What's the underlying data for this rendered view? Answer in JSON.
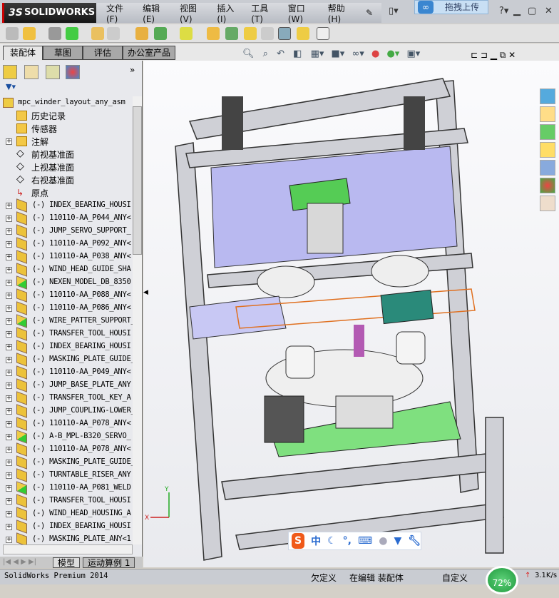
{
  "app": {
    "brand": "SOLIDWORKS",
    "edition": "SolidWorks Premium 2014"
  },
  "menu": [
    "文件(F)",
    "编辑(E)",
    "视图(V)",
    "插入(I)",
    "工具(T)",
    "窗口(W)",
    "帮助(H)"
  ],
  "upload_popup": "拖拽上传",
  "tabs": [
    "装配体",
    "草图",
    "评估",
    "办公室产品"
  ],
  "tree": {
    "root": "mpc_winder_layout_any_asm",
    "folders": [
      "历史记录",
      "传感器",
      "注解",
      "前视基准面",
      "上视基准面",
      "右视基准面",
      "原点"
    ],
    "components": [
      {
        "name": "(-) INDEX_BEARING_HOUSI",
        "type": "part"
      },
      {
        "name": "(-) 110110-AA_P044_ANY<",
        "type": "part"
      },
      {
        "name": "(-) JUMP_SERVO_SUPPORT_",
        "type": "part"
      },
      {
        "name": "(-) 110110-AA_P092_ANY<",
        "type": "part"
      },
      {
        "name": "(-) 110110-AA_P038_ANY<",
        "type": "part"
      },
      {
        "name": "(-) WIND_HEAD_GUIDE_SHA",
        "type": "part"
      },
      {
        "name": "(-) NEXEN_MODEL_DB_8350",
        "type": "assembly"
      },
      {
        "name": "(-) 110110-AA_P088_ANY<",
        "type": "part"
      },
      {
        "name": "(-) 110110-AA_P086_ANY<",
        "type": "part"
      },
      {
        "name": "(-) WIRE_PATTER_SUPPORT_",
        "type": "assembly"
      },
      {
        "name": "(-) TRANSFER_TOOL_HOUSI",
        "type": "part"
      },
      {
        "name": "(-) INDEX_BEARING_HOUSI",
        "type": "part"
      },
      {
        "name": "(-) MASKING_PLATE_GUIDE_",
        "type": "part"
      },
      {
        "name": "(-) 110110-AA_P049_ANY<",
        "type": "part"
      },
      {
        "name": "(-) JUMP_BASE_PLATE_ANY",
        "type": "part"
      },
      {
        "name": "(-) TRANSFER_TOOL_KEY_A",
        "type": "part"
      },
      {
        "name": "(-) JUMP_COUPLING-LOWER_",
        "type": "part"
      },
      {
        "name": "(-) 110110-AA_P078_ANY<",
        "type": "part"
      },
      {
        "name": "(-) A-B_MPL-B320_SERVO_",
        "type": "assembly"
      },
      {
        "name": "(-) 110110-AA_P078_ANY<",
        "type": "part"
      },
      {
        "name": "(-) MASKING_PLATE_GUIDE_",
        "type": "part"
      },
      {
        "name": "(-) TURNTABLE_RISER_ANY",
        "type": "part"
      },
      {
        "name": "(-) 110110-AA_P081_WELD",
        "type": "assembly"
      },
      {
        "name": "(-) TRANSFER_TOOL_HOUSI",
        "type": "part"
      },
      {
        "name": "(-) WIND_HEAD_HOUSING_A",
        "type": "part"
      },
      {
        "name": "(-) INDEX_BEARING_HOUSI",
        "type": "part"
      },
      {
        "name": "(-) MASKING_PLATE_ANY<1",
        "type": "part"
      }
    ]
  },
  "bottom_tabs": [
    "模型",
    "运动算例 1"
  ],
  "status": {
    "left": "SolidWorks Premium 2014",
    "defined": "欠定义",
    "editing": "在编辑 装配体",
    "custom": "自定义"
  },
  "net": {
    "percent": "72%",
    "speed": "3.1K/s"
  },
  "ime": {
    "logo": "S",
    "mode": "中"
  },
  "colors": {
    "panel": "#b9b9f0",
    "plate": "#7fe07f",
    "frame": "#c8c8cc",
    "motor": "#2a8a7a"
  }
}
